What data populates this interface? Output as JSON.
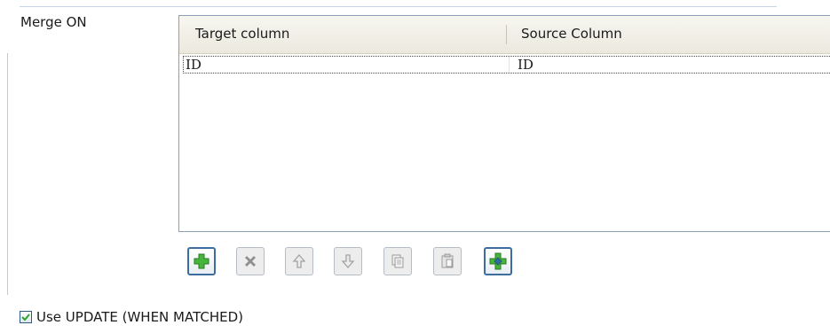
{
  "section": {
    "label": "Merge ON"
  },
  "table": {
    "columns": [
      "Target column",
      "Source Column"
    ],
    "rows": [
      [
        "ID",
        "ID"
      ]
    ]
  },
  "toolbar": {
    "buttons": [
      {
        "icon": "add-icon",
        "enabled": true
      },
      {
        "icon": "delete-icon",
        "enabled": false
      },
      {
        "icon": "move-up-icon",
        "enabled": false
      },
      {
        "icon": "move-down-icon",
        "enabled": false
      },
      {
        "icon": "copy-icon",
        "enabled": false
      },
      {
        "icon": "paste-icon",
        "enabled": false
      },
      {
        "icon": "add-all-icon",
        "enabled": true
      }
    ]
  },
  "options": {
    "use_update": {
      "label": "Use UPDATE (WHEN MATCHED)",
      "checked": true
    }
  },
  "colors": {
    "accent": "#3d6d9e",
    "plus_green": "#3fae3a",
    "check": "#2ba62b"
  }
}
